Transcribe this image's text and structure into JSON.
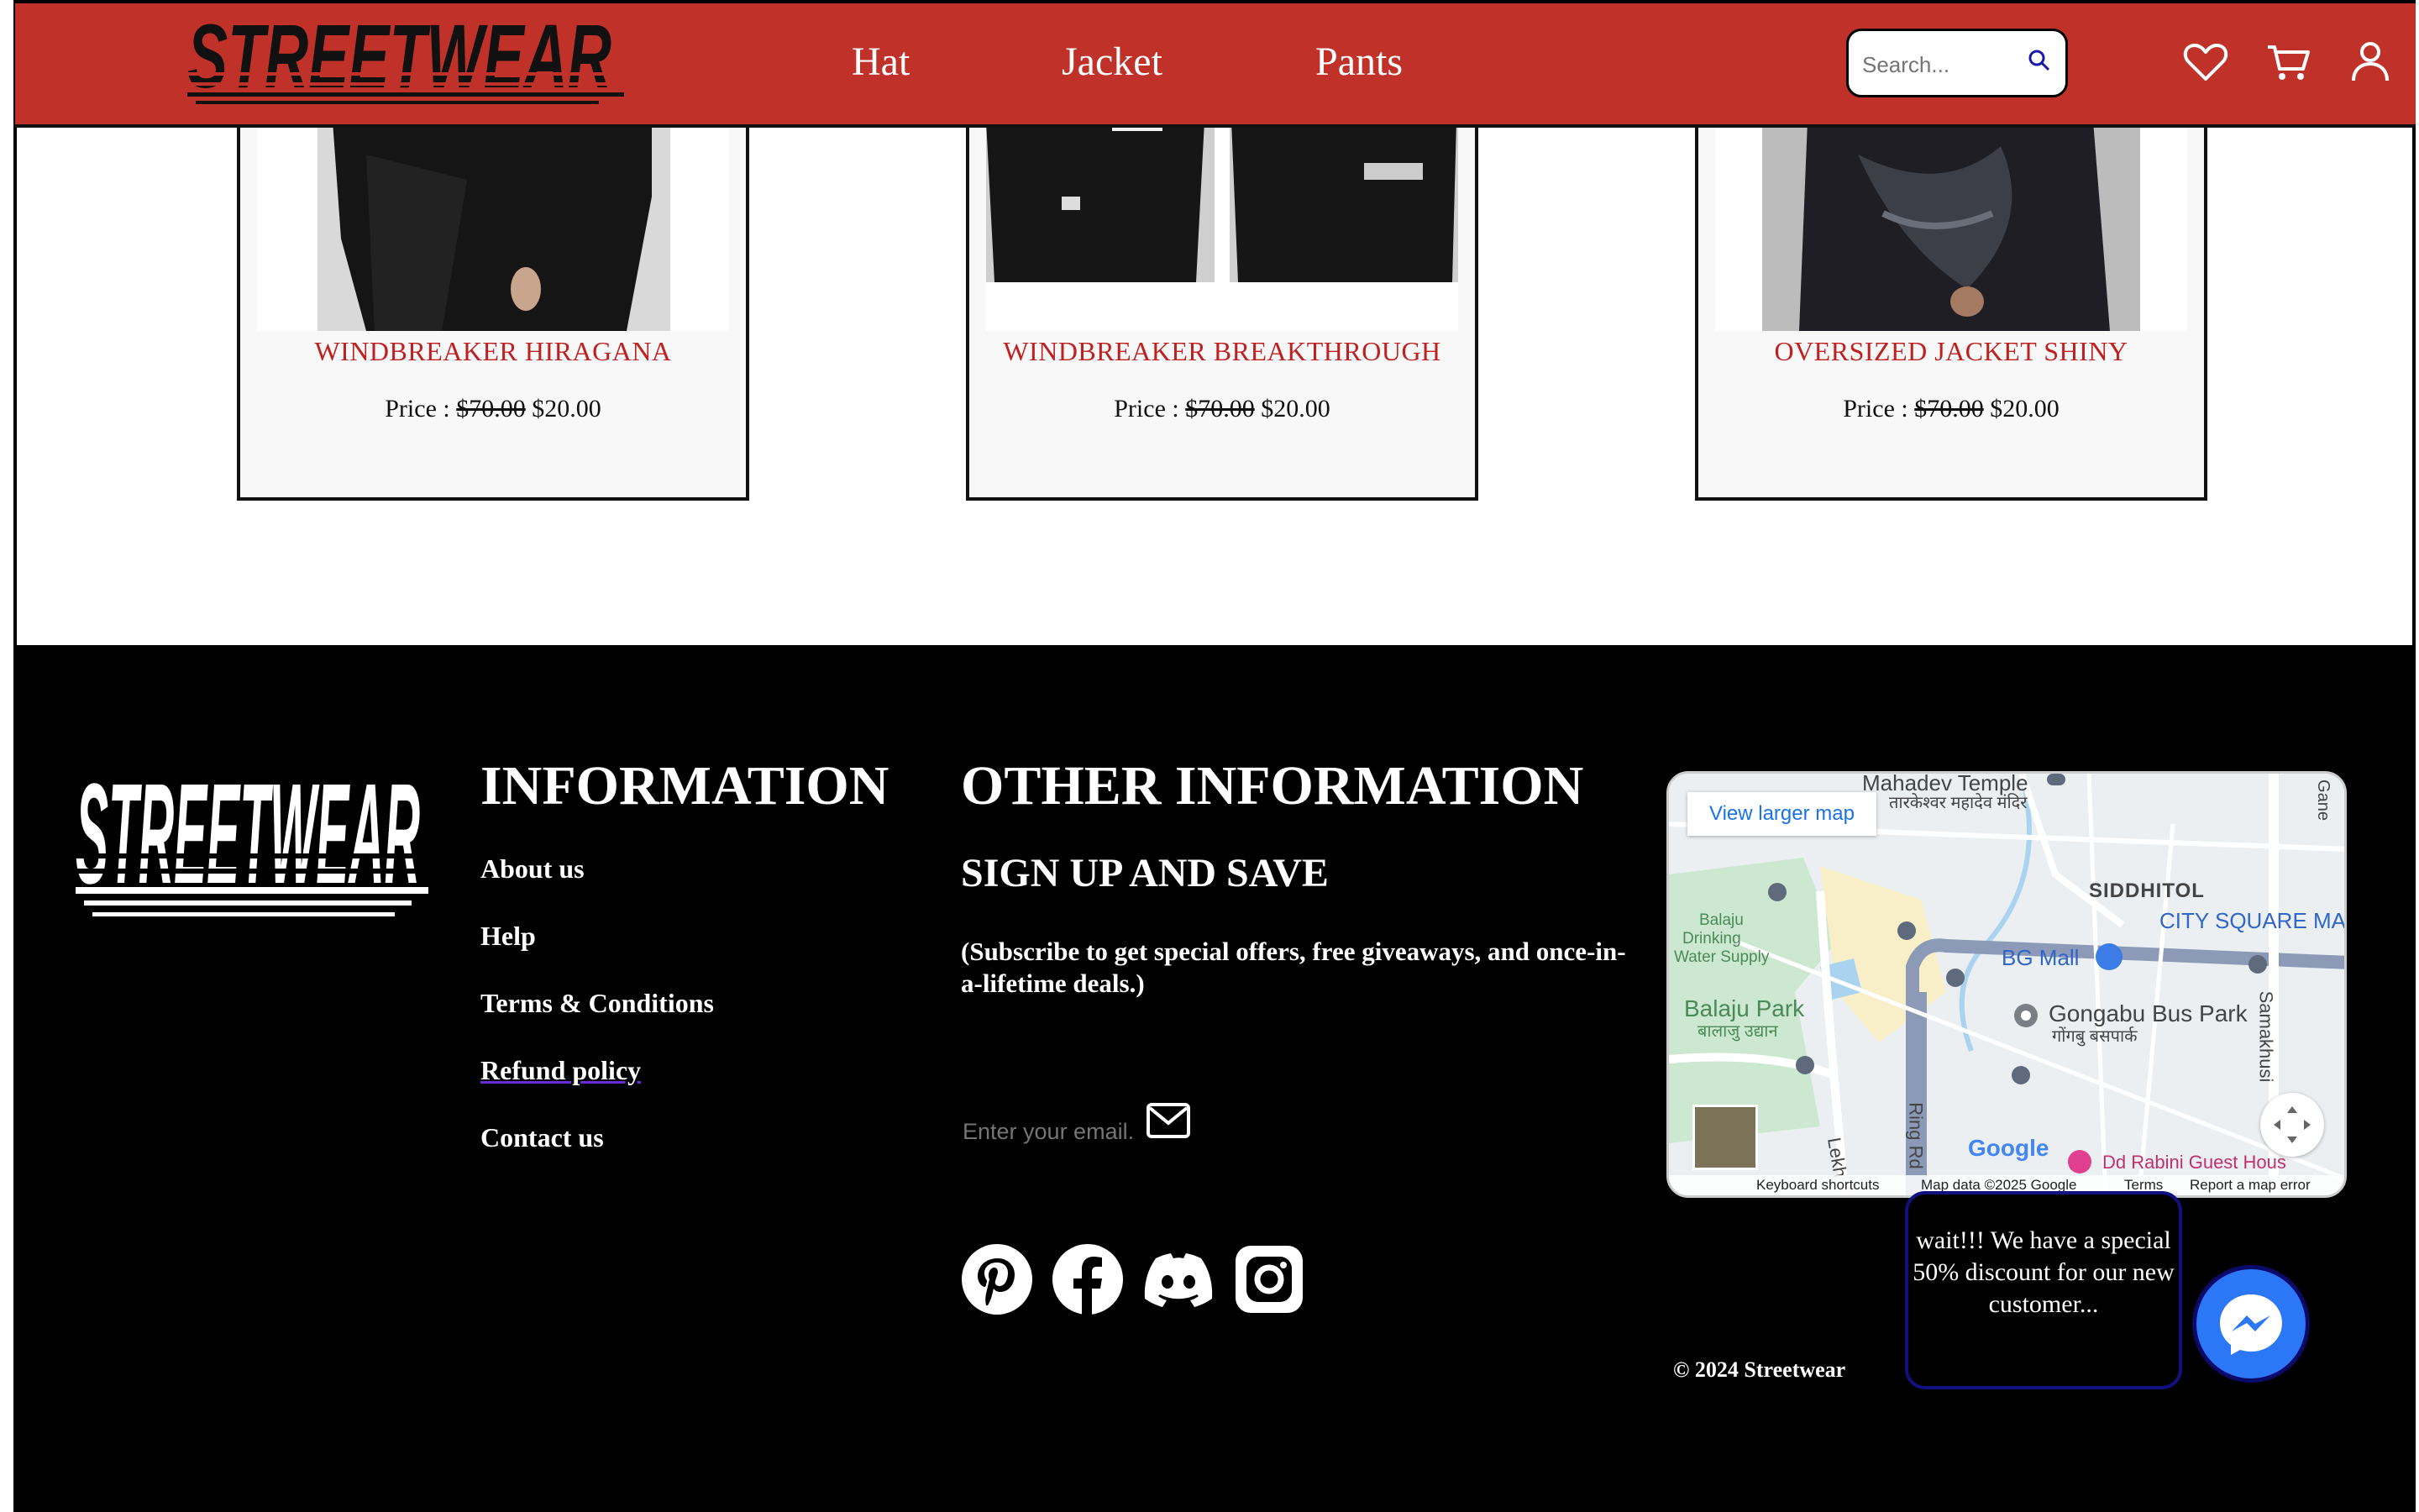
{
  "brand": {
    "logo_text": "STREETWEAR"
  },
  "nav": {
    "items": [
      "Hat",
      "Jacket",
      "Pants"
    ]
  },
  "search": {
    "placeholder": "Search..."
  },
  "header_icons": [
    "heart-icon",
    "cart-icon",
    "user-icon"
  ],
  "products": [
    {
      "name": "WINDBREAKER HIRAGANA",
      "price_label": "Price :",
      "old_price": "$70.00",
      "new_price": "$20.00"
    },
    {
      "name": "WINDBREAKER BREAKTHROUGH",
      "price_label": "Price :",
      "old_price": "$70.00",
      "new_price": "$20.00"
    },
    {
      "name": "OVERSIZED JACKET SHINY",
      "price_label": "Price :",
      "old_price": "$70.00",
      "new_price": "$20.00"
    }
  ],
  "footer": {
    "information_title": "INFORMATION",
    "links": [
      "About us",
      "Help",
      "Terms & Conditions",
      "Refund policy",
      "Contact us"
    ],
    "other_title": "OTHER INFORMATION",
    "signup_title": "SIGN UP AND SAVE",
    "signup_desc": "(Subscribe to get special offers, free giveaways, and once-in-a-lifetime deals.)",
    "email_placeholder": "Enter your email.",
    "social": [
      "pinterest-icon",
      "facebook-icon",
      "discord-icon",
      "instagram-icon"
    ],
    "copyright": "© 2024 Streetwear"
  },
  "map": {
    "view_larger": "View larger map",
    "labels": {
      "temple": "Mahadev Temple",
      "temple_local": "तारकेश्वर महादेव मंदिर",
      "siddhitol": "SIDDHITOL",
      "city_square": "CITY SQUARE MA",
      "balaju_water_1": "Balaju",
      "balaju_water_2": "Drinking",
      "balaju_water_3": "Water Supply",
      "bg_mall": "BG Mall",
      "balaju_park": "Balaju Park",
      "balaju_park_local": "बालाजु उद्यान",
      "gongabu": "Gongabu Bus Park",
      "gongabu_local": "गोंगबु बसपार्क",
      "ring_rd": "Ring Rd",
      "lekh": "Lekh",
      "samakhusi": "Samakhusi",
      "gane": "Gane",
      "guest_house": "Dd Rabini Guest Hous"
    },
    "attribution": {
      "keyboard": "Keyboard shortcuts",
      "data": "Map data ©2025 Google",
      "terms": "Terms",
      "report": "Report a map error"
    },
    "google": "Google"
  },
  "popup": {
    "text": "wait!!! We have a special 50% discount for our new customer..."
  },
  "colors": {
    "header": "#bf3129",
    "product_name": "#bf2020",
    "footer_bg": "#000000",
    "messenger": "#2b77f6"
  }
}
